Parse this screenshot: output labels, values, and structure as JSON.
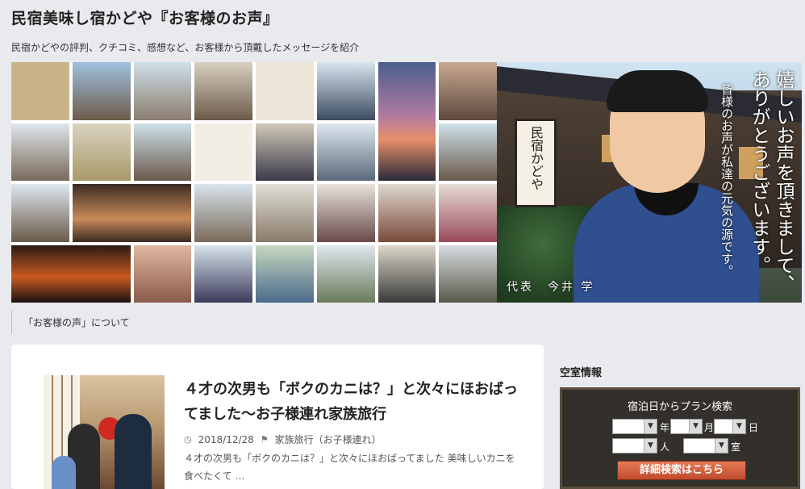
{
  "site": {
    "title": "民宿美味し宿かどや『お客様のお声』",
    "description": "民宿かどやの評判、クチコミ、感想など、お客様から頂戴したメッセージを紹介"
  },
  "header_image": {
    "sign_text": "民宿かどや",
    "thanks_main": "嬉しいお声を頂きまして、ありがとうございます。",
    "thanks_sub": "皆様のお声が私達の元気の源です。",
    "representative": "代表　今井 学"
  },
  "breadcrumb": {
    "label": "「お客様の声」について"
  },
  "post": {
    "title": "４才の次男も「ボクのカニは？」と次々にほおばってました～お子様連れ家族旅行",
    "date": "2018/12/28",
    "category": "家族旅行（お子様連れ）",
    "excerpt": "４才の次男も「ボクのカニは？」と次々にほおばってました 美味しいカニを食べたくて …",
    "date_icon": "clock-icon",
    "category_icon": "tag-icon"
  },
  "sidebar": {
    "widget_title": "空室情報",
    "search_title": "宿泊日からプラン検索",
    "year_unit": "年",
    "month_unit": "月",
    "day_unit": "日",
    "people_unit": "人",
    "room_unit": "室",
    "detail_button": "詳細検索はこちら"
  }
}
